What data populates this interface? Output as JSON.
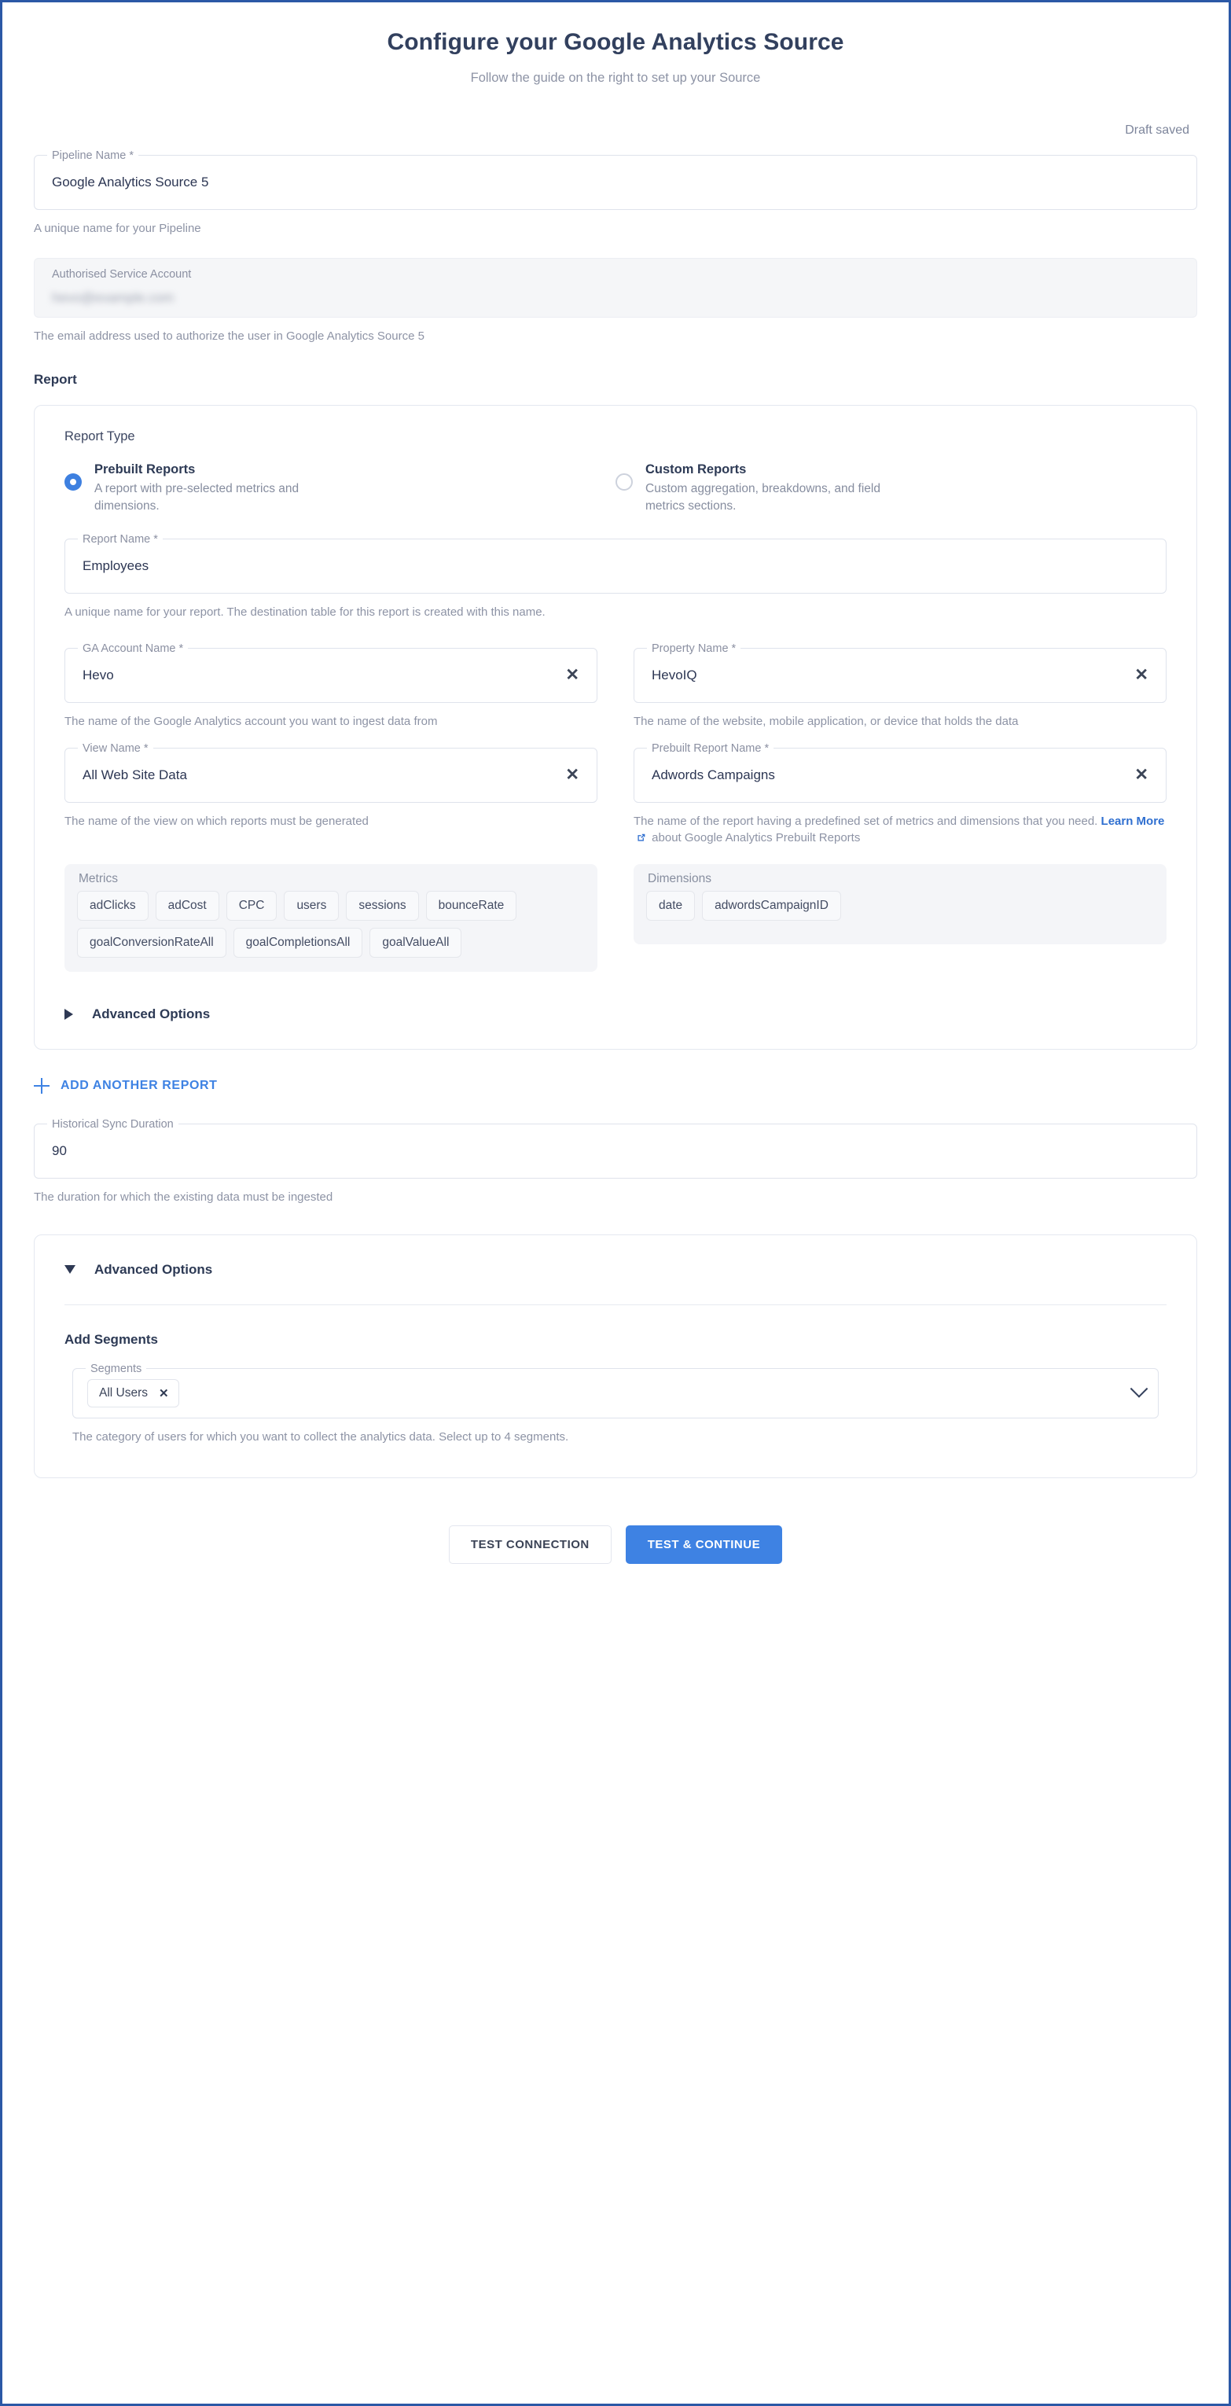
{
  "header": {
    "title": "Configure your Google Analytics Source",
    "subtitle": "Follow the guide on the right to set up your Source",
    "draft_status": "Draft saved"
  },
  "pipeline_name": {
    "label": "Pipeline Name *",
    "value": "Google Analytics Source 5",
    "hint": "A unique name for your Pipeline"
  },
  "service_account": {
    "label": "Authorised Service Account",
    "value": "hevo@example.com",
    "hint": "The email address used to authorize the user in Google Analytics Source 5"
  },
  "report_section": {
    "heading": "Report",
    "report_type_label": "Report Type",
    "options": [
      {
        "title": "Prebuilt Reports",
        "description": "A report with pre-selected metrics and dimensions.",
        "selected": true
      },
      {
        "title": "Custom Reports",
        "description": "Custom aggregation, breakdowns, and field metrics sections.",
        "selected": false
      }
    ],
    "report_name": {
      "label": "Report Name *",
      "value": "Employees",
      "hint": "A unique name for your report. The destination table for this report is created with this name."
    },
    "ga_account": {
      "label": "GA Account Name *",
      "value": "Hevo",
      "hint": "The name of the Google Analytics account you want to ingest data from"
    },
    "property_name": {
      "label": "Property Name *",
      "value": "HevoIQ",
      "hint": "The name of the website, mobile application, or device that holds the data"
    },
    "view_name": {
      "label": "View Name *",
      "value": "All Web Site Data",
      "hint": "The name of the view on which reports must be generated"
    },
    "prebuilt_report_name": {
      "label": "Prebuilt Report Name *",
      "value": "Adwords Campaigns",
      "hint_before": "The name of the report having a predefined set of metrics and dimensions that you need.",
      "hint_link": "Learn More",
      "hint_after": "about Google Analytics Prebuilt Reports"
    },
    "metrics": {
      "label": "Metrics",
      "items": [
        "adClicks",
        "adCost",
        "CPC",
        "users",
        "sessions",
        "bounceRate",
        "goalConversionRateAll",
        "goalCompletionsAll",
        "goalValueAll"
      ]
    },
    "dimensions": {
      "label": "Dimensions",
      "items": [
        "date",
        "adwordsCampaignID"
      ]
    },
    "advanced_options_label": "Advanced Options",
    "add_another_report_label": "ADD ANOTHER REPORT"
  },
  "historical_sync": {
    "label": "Historical Sync Duration",
    "value": "90",
    "hint": "The duration for which the existing data must be ingested"
  },
  "advanced": {
    "label": "Advanced Options",
    "add_segments_title": "Add Segments",
    "segments_label": "Segments",
    "segments_chips": [
      "All Users"
    ],
    "segments_hint": "The category of users for which you want to collect the analytics data. Select up to 4 segments."
  },
  "footer": {
    "test_connection": "TEST CONNECTION",
    "test_continue": "TEST & CONTINUE"
  },
  "colors": {
    "accent": "#3e82e3",
    "border": "#2b58a6",
    "text": "#2d3a55",
    "muted": "#8d93a5"
  }
}
